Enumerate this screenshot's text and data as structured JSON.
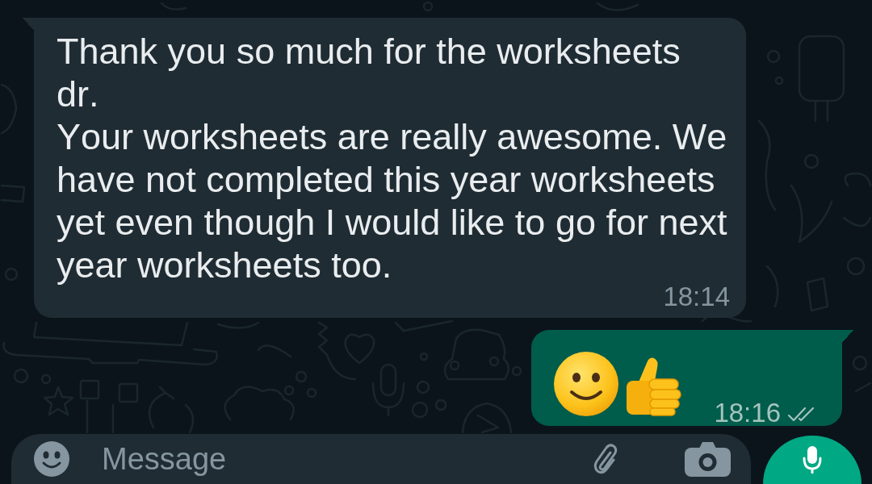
{
  "messages": [
    {
      "kind": "incoming",
      "text": "Thank you so much for the worksheets dr.\nYour worksheets are really awesome. We have not completed this year worksheets yet even though I would like to go for next year worksheets too.",
      "time": "18:14"
    },
    {
      "kind": "outgoing",
      "emojis": [
        {
          "kind": "smile"
        },
        {
          "kind": "thumbsup"
        }
      ],
      "time": "18:16",
      "read": false
    }
  ],
  "composer": {
    "placeholder": "Message"
  }
}
